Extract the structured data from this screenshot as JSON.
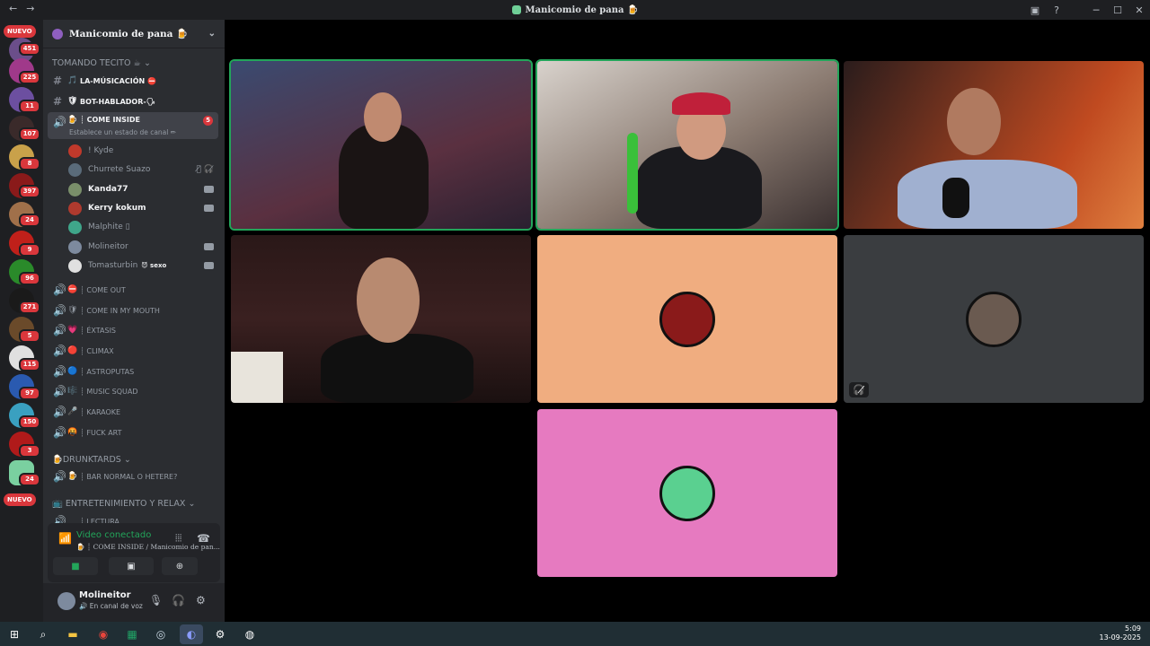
{
  "window": {
    "title": "Manicomio de pana 🍺"
  },
  "server": {
    "name": "Manicomio de pana 🍺"
  },
  "server_badges": [
    {
      "count": "451"
    },
    {
      "count": "225"
    },
    {
      "count": "11"
    },
    {
      "count": "107"
    },
    {
      "count": "8"
    },
    {
      "count": "397"
    },
    {
      "count": "24"
    },
    {
      "count": "9"
    },
    {
      "count": "96"
    },
    {
      "count": "271"
    },
    {
      "count": "5"
    },
    {
      "count": "115"
    },
    {
      "count": "97"
    },
    {
      "count": "150"
    },
    {
      "count": "3"
    },
    {
      "count": "24"
    }
  ],
  "nuevo_label": "NUEVO",
  "categories": {
    "tomando": "TOMANDO TECITO ☕",
    "drunktards": "DRUNKTARDS",
    "entretenimiento": "ENTRETENIMIENTO Y RELAX"
  },
  "channels": [
    {
      "emoji": "🎵",
      "label": "LA-MÚSICACIÓN ⛔"
    },
    {
      "emoji": "🛡",
      "label": "BOT-HABLADOR-🗣"
    },
    {
      "emoji": "🍺",
      "label": "┊ COME INSIDE",
      "badge": "5",
      "status": "Establece un estado de canal ✏"
    },
    {
      "emoji": "⛔",
      "label": "┊ COME OUT"
    },
    {
      "emoji": "🛡",
      "label": "┊ COME IN MY MOUTH"
    },
    {
      "emoji": "💗",
      "label": "┊ ÉXTASIS"
    },
    {
      "emoji": "🔴",
      "label": "┊ CLIMAX"
    },
    {
      "emoji": "🔵",
      "label": "┊ ASTROPUTAS"
    },
    {
      "emoji": "🎼",
      "label": "┊ MUSIC SQUAD"
    },
    {
      "emoji": "🎤",
      "label": "┊ KARAOKE"
    },
    {
      "emoji": "🤬",
      "label": "┊ FUCK ART"
    },
    {
      "emoji": "🍺",
      "label": "┊ BAR NORMAL O HETERE?"
    },
    {
      "emoji": "",
      "label": "┊ LECTURA"
    }
  ],
  "voice_users": [
    {
      "name": "! Kyde",
      "color": "#c0392b"
    },
    {
      "name": "Churrete Suazo",
      "color": "#5a6b7a",
      "mutes": "🎙̸ 🎧̸"
    },
    {
      "name": "Kanda77",
      "color": "#7a8f6a",
      "bold": true
    },
    {
      "name": "Kerry kokum",
      "color": "#b03a2e",
      "bold": true
    },
    {
      "name": "Malphite ▯",
      "color": "#3fa68a"
    },
    {
      "name": "Molineitor",
      "color": "#7d8a9e"
    },
    {
      "name": "Tomasturbin",
      "color": "#e0e0e0",
      "tag": "😈 sexo"
    }
  ],
  "voice_panel": {
    "status": "Video conectado",
    "sub": "🍺 ┊ COME INSIDE / Manicomio de pan..."
  },
  "user_panel": {
    "name": "Molineitor",
    "status": "🔊 En canal de voz"
  },
  "clock": {
    "time": "5:09",
    "date": "13-09-2025"
  },
  "colors": {
    "accent_green": "#23a55a",
    "tile_peach": "#f0ad80",
    "tile_gray": "#3a3d40",
    "tile_pink": "#e67ac0",
    "badge_red": "#da373c"
  }
}
